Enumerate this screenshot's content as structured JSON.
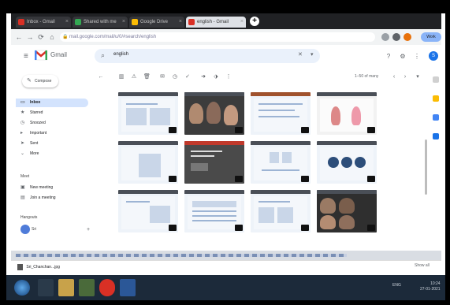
{
  "browser": {
    "tabs": [
      {
        "label": "Inbox - Gmail"
      },
      {
        "label": "Shared with me"
      },
      {
        "label": "Google Drive"
      },
      {
        "label": "english - Gmail"
      }
    ],
    "new_tab_symbol": "+",
    "url": "mail.google.com/mail/u/0/#search/english",
    "profile_label": "Work"
  },
  "gmail": {
    "product_name": "Gmail",
    "search_query": "english",
    "compose_label": "Compose",
    "avatar_letter": "S",
    "nav": [
      {
        "label": "Inbox",
        "count": "",
        "icon": "inbox-icon",
        "active": true
      },
      {
        "label": "Starred",
        "count": "",
        "icon": "star-icon",
        "active": false
      },
      {
        "label": "Snoozed",
        "count": "",
        "icon": "clock-icon",
        "active": false
      },
      {
        "label": "Important",
        "count": "",
        "icon": "important-icon",
        "active": false
      },
      {
        "label": "Sent",
        "count": "",
        "icon": "send-icon",
        "active": false
      },
      {
        "label": "More",
        "count": "",
        "icon": "chevron-down-icon",
        "active": false
      }
    ],
    "meet_title": "Meet",
    "meet_items": [
      "New meeting",
      "Join a meeting"
    ],
    "hangouts_title": "Hangouts",
    "hangouts_user": "Sri",
    "page_count": "1–50 of many"
  },
  "downloads": {
    "item_label": "Sri_Chanchan...jpg",
    "show_all": "Show all"
  },
  "taskbar": {
    "tray_text": "ENG",
    "time": "10:24",
    "date": "27-01-2021"
  },
  "colors": {
    "gmail_red": "#d93025",
    "accent_blue": "#1a73e8",
    "nav_active_bg": "#d3e3fd",
    "taskbar_bg": "#1c2a3a"
  }
}
